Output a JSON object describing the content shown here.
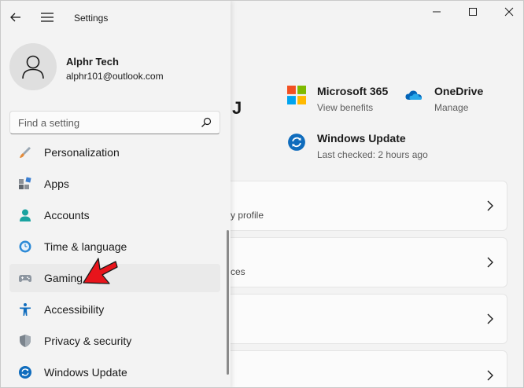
{
  "app": {
    "title": "Settings"
  },
  "user": {
    "name": "Alphr Tech",
    "email": "alphr101@outlook.com",
    "initial_fragment": "J"
  },
  "search": {
    "placeholder": "Find a setting"
  },
  "nav": {
    "items": [
      {
        "label": "Personalization",
        "icon": "paint-brush-icon"
      },
      {
        "label": "Apps",
        "icon": "apps-icon"
      },
      {
        "label": "Accounts",
        "icon": "accounts-icon"
      },
      {
        "label": "Time & language",
        "icon": "time-language-icon"
      },
      {
        "label": "Gaming",
        "icon": "gaming-controller-icon",
        "active": true
      },
      {
        "label": "Accessibility",
        "icon": "accessibility-icon"
      },
      {
        "label": "Privacy & security",
        "icon": "shield-icon"
      },
      {
        "label": "Windows Update",
        "icon": "windows-update-icon"
      }
    ]
  },
  "services": {
    "microsoft365": {
      "title": "Microsoft 365",
      "sub": "View benefits"
    },
    "onedrive": {
      "title": "OneDrive",
      "sub": "Manage"
    },
    "windows_update": {
      "title": "Windows Update",
      "sub": "Last checked: 2 hours ago"
    }
  },
  "cards": [
    {
      "fragment": "y profile"
    },
    {
      "fragment": "ces"
    },
    {
      "fragment": ""
    },
    {
      "fragment": ""
    }
  ],
  "colors": {
    "accent": "#0067c0",
    "arrow": "#e8141b"
  }
}
